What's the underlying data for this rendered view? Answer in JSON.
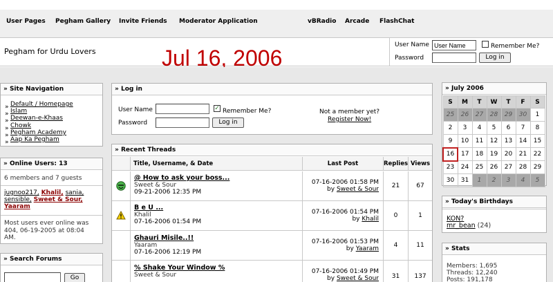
{
  "nav": {
    "items": [
      "User Pages",
      "Pegham Gallery",
      "Invite Friends",
      "Moderator Application",
      "vBRadio",
      "Arcade",
      "FlashChat"
    ]
  },
  "header": {
    "site_name": "Pegham for Urdu Lovers",
    "date": "Jul 16, 2006",
    "username_label": "User Name",
    "username_value": "User Name",
    "remember_label": "Remember Me?",
    "password_label": "Password",
    "login_button": "Log in"
  },
  "site_nav": {
    "title": "Site Navigation",
    "links": [
      "Default / Homepage",
      "Islam",
      "Deewan-e-Khaas",
      "Chowk",
      "Pegham Academy",
      "Aap Ka Pegham"
    ]
  },
  "online": {
    "title": "Online Users: 13",
    "summary": "6 members and 7 guests",
    "users_line1": [
      "jugnoo217,",
      "Khalil,",
      "sania,"
    ],
    "users_line2": [
      "sensible,",
      "Sweet & Sour,"
    ],
    "users_line3": [
      "Yaaram"
    ],
    "record_line1": "Most users ever online was",
    "record_line2": "404, 06-19-2005 at 08:04",
    "record_line3": "AM."
  },
  "search": {
    "title": "Search Forums",
    "go": "Go"
  },
  "login_box": {
    "title": "Log in",
    "username_label": "User Name",
    "password_label": "Password",
    "remember_label": "Remember Me?",
    "login_button": "Log in",
    "not_member": "Not a member yet?",
    "register": "Register Now!"
  },
  "threads": {
    "title": "Recent Threads",
    "headers": {
      "title": "Title, Username, & Date",
      "last": "Last Post",
      "replies": "Replies",
      "views": "Views"
    },
    "rows": [
      {
        "icon": "smiley",
        "title": "@ How to ask your boss...",
        "user": "Sweet & Sour",
        "date": "09-21-2006 12:35 PM",
        "last_date": "07-16-2006 01:58 PM",
        "last_by": "Sweet & Sour",
        "replies": "21",
        "views": "67"
      },
      {
        "icon": "warning",
        "title": "B e U ...",
        "user": "Khalil",
        "date": "07-16-2006 01:54 PM",
        "last_date": "07-16-2006 01:54 PM",
        "last_by": "Khalil",
        "replies": "0",
        "views": "1"
      },
      {
        "icon": "none",
        "title": "Ghauri Misile..!!",
        "user": "Yaaram",
        "date": "07-16-2006 12:19 PM",
        "last_date": "07-16-2006 01:53 PM",
        "last_by": "Yaaram",
        "replies": "4",
        "views": "11"
      },
      {
        "icon": "none",
        "title": "% Shake Your Window %",
        "user": "Sweet & Sour",
        "date": "",
        "last_date": "07-16-2006 01:49 PM",
        "last_by": "Sweet & Sour",
        "replies": "31",
        "views": "137"
      }
    ],
    "by": "by"
  },
  "calendar": {
    "title": "July 2006",
    "days": [
      "S",
      "M",
      "T",
      "W",
      "T",
      "F",
      "S"
    ],
    "weeks": [
      [
        "25",
        "26",
        "27",
        "28",
        "29",
        "30",
        "1"
      ],
      [
        "2",
        "3",
        "4",
        "5",
        "6",
        "7",
        "8"
      ],
      [
        "9",
        "10",
        "11",
        "12",
        "13",
        "14",
        "15"
      ],
      [
        "16",
        "17",
        "18",
        "19",
        "20",
        "21",
        "22"
      ],
      [
        "23",
        "24",
        "25",
        "26",
        "27",
        "28",
        "29"
      ],
      [
        "30",
        "31",
        "1",
        "2",
        "3",
        "4",
        "5"
      ]
    ]
  },
  "birthdays": {
    "title": "Today's Birthdays",
    "line1": "KON?",
    "line2_name": "mr_bean",
    "line2_age": "(24)"
  },
  "stats": {
    "title": "Stats",
    "members": "Members: 1,695",
    "threads": "Threads: 12,240",
    "posts": "Posts: 191,178"
  }
}
